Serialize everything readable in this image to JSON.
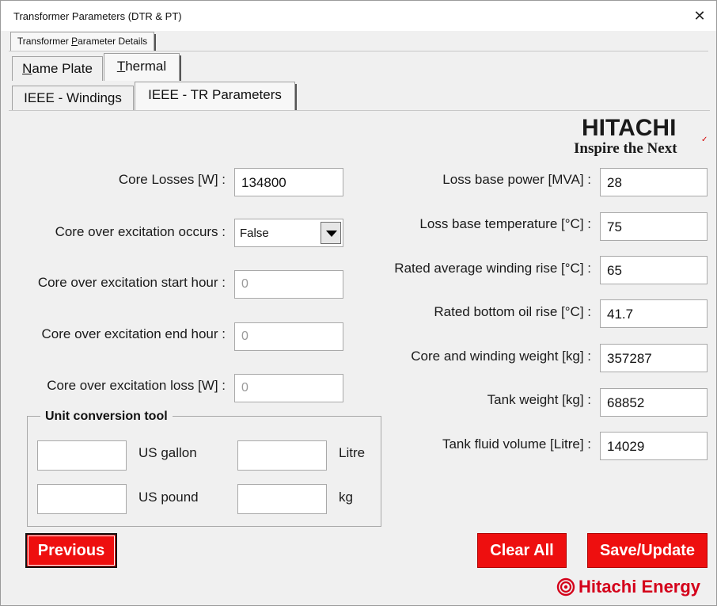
{
  "window": {
    "title": "Transformer Parameters (DTR & PT)"
  },
  "tabs": {
    "outer": "Transformer Parameter Details",
    "level1": [
      "Name Plate",
      "Thermal"
    ],
    "level2": [
      "IEEE - Windings",
      "IEEE - TR Parameters"
    ]
  },
  "left_fields": {
    "core_losses": {
      "label": "Core Losses [W] :",
      "value": "134800"
    },
    "core_oe_occurs": {
      "label": "Core over excitation occurs :",
      "value": "False"
    },
    "core_oe_start": {
      "label": "Core over excitation start hour :",
      "value": "0"
    },
    "core_oe_end": {
      "label": "Core over excitation end hour :",
      "value": "0"
    },
    "core_oe_loss": {
      "label": "Core over excitation loss [W] :",
      "value": "0"
    }
  },
  "right_fields": {
    "loss_base_power": {
      "label": "Loss base power [MVA] :",
      "value": "28"
    },
    "loss_base_temp": {
      "label": "Loss base temperature [°C] :",
      "value": "75"
    },
    "rated_avg_winding_rise": {
      "label": "Rated average winding rise [°C] :",
      "value": "65"
    },
    "rated_bottom_oil_rise": {
      "label": "Rated bottom oil rise [°C] :",
      "value": "41.7"
    },
    "core_winding_weight": {
      "label": "Core and winding weight [kg] :",
      "value": "357287"
    },
    "tank_weight": {
      "label": "Tank weight [kg] :",
      "value": "68852"
    },
    "tank_fluid_volume": {
      "label": "Tank fluid volume [Litre] :",
      "value": "14029"
    }
  },
  "unit_tool": {
    "title": "Unit conversion tool",
    "us_gallon": "US gallon",
    "litre": "Litre",
    "us_pound": "US pound",
    "kg": "kg"
  },
  "buttons": {
    "previous": "Previous",
    "clear_all": "Clear All",
    "save_update": "Save/Update"
  },
  "logos": {
    "hitachi": "HITACHI",
    "hitachi_tagline": "Inspire the Next",
    "energy": "Hitachi Energy"
  },
  "colors": {
    "button_red": "#ee0f0f",
    "energy_red": "#d4001a"
  }
}
